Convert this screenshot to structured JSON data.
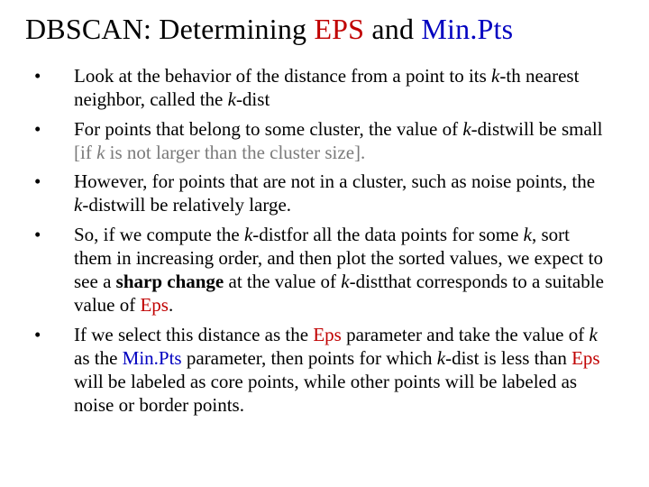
{
  "title": {
    "t1": "DBSCAN: Determining ",
    "eps": "EPS",
    "and": " and ",
    "minpts": "Min.Pts"
  },
  "bullets": [
    {
      "p1": "Look at the behavior of the distance from a point to its ",
      "k1": "k",
      "p2": "-th nearest neighbor, called the ",
      "k2": "k",
      "p3": "-dist"
    },
    {
      "p1": "For points that belong to some cluster, the value of ",
      "k1": "k",
      "p2": "-dist",
      "p3": "will be small ",
      "grey1": "[if ",
      "gk": "k",
      "grey2": " is not larger than the cluster size].",
      "tail": ""
    },
    {
      "p1": "However, for points that are not in a cluster, such as noise points, the ",
      "k1": "k",
      "p2": "-dist",
      "p3": "will be relatively large."
    },
    {
      "p1": "So, if we compute the ",
      "k1": "k",
      "p2": "-dist",
      "p3": "for all the data points for some ",
      "k2": "k",
      "p4": ", sort them in increasing order, and then plot the sorted values, we expect to see a ",
      "bold": "sharp change",
      "p5": " at the value of ",
      "k3": "k",
      "p6": "-dist",
      "p7": "that corresponds to a suitable value of ",
      "eps": "Eps",
      "p8": "."
    },
    {
      "p1": "If we select this distance as the ",
      "eps1": "Eps",
      "p2": " parameter and take the value of ",
      "k1": "k",
      "p3": " as the ",
      "minpts": "Min.Pts",
      "p4": " parameter, then points for which ",
      "k2": "k",
      "p5": "-dist is less than ",
      "eps2": "Eps",
      "p6": " will be labeled as core points, while other points will be labeled as noise or border points."
    }
  ]
}
